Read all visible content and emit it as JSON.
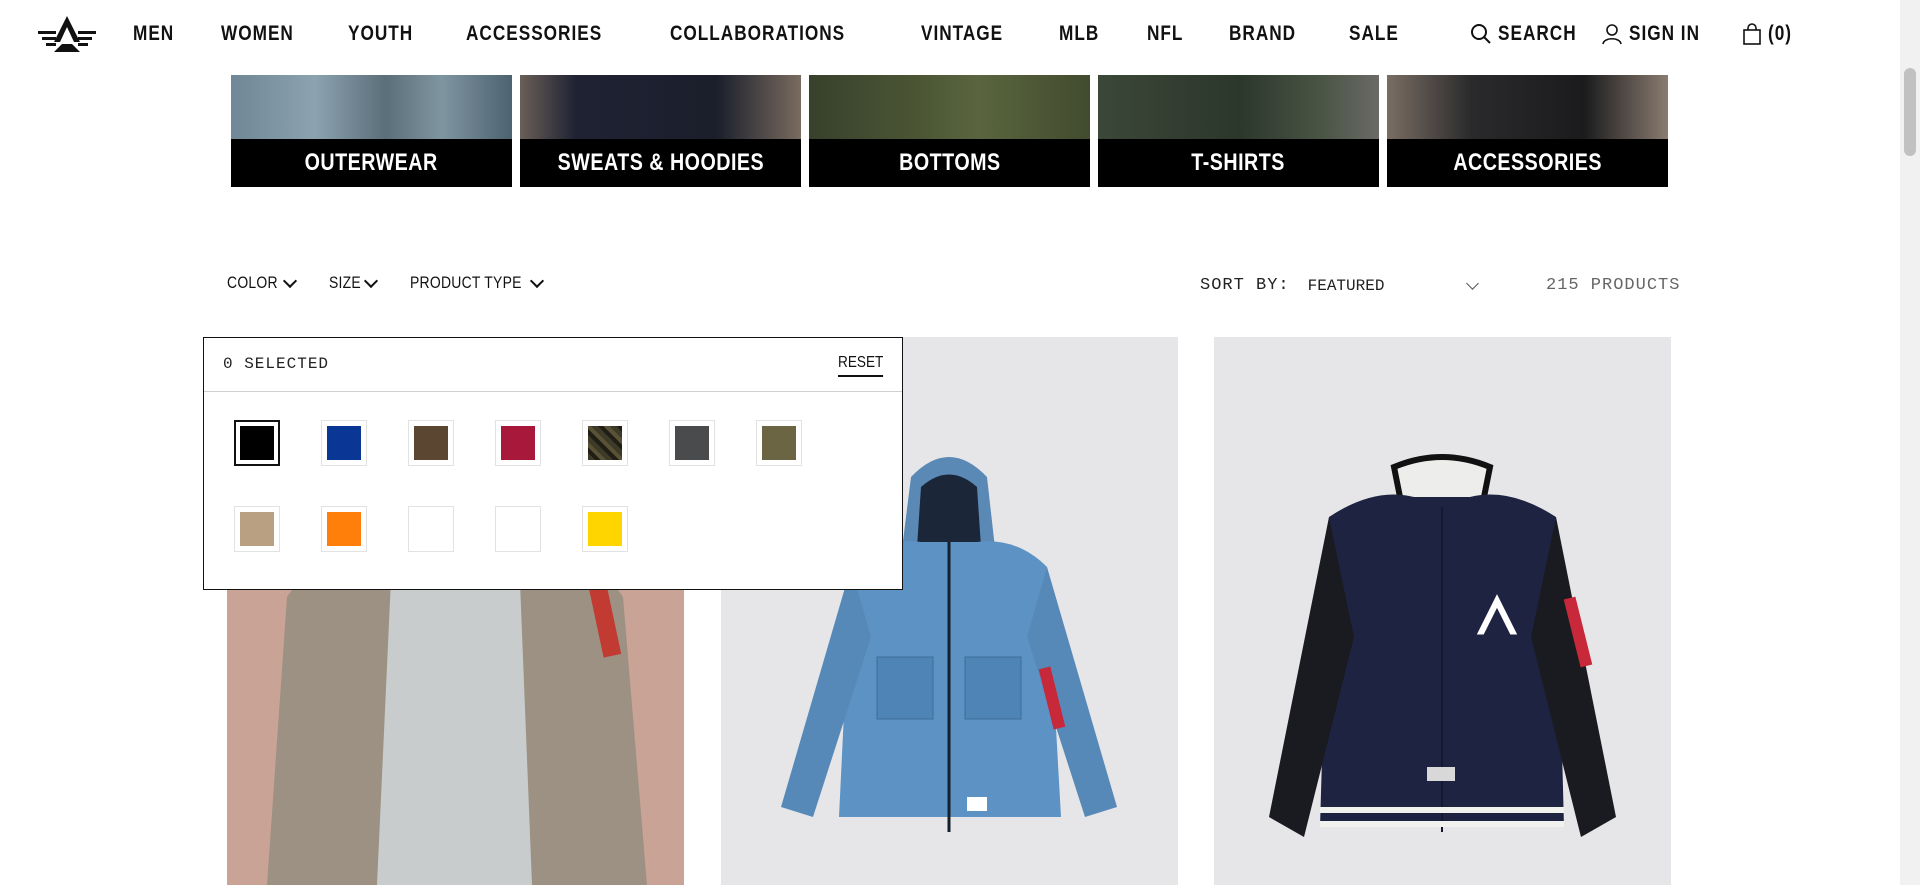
{
  "header": {
    "nav": [
      "MEN",
      "WOMEN",
      "YOUTH",
      "ACCESSORIES",
      "COLLABORATIONS",
      "VINTAGE",
      "MLB",
      "NFL",
      "BRAND",
      "SALE"
    ],
    "search_label": "SEARCH",
    "signin_label": "SIGN IN",
    "cart_label": "(0)"
  },
  "categories": [
    "OUTERWEAR",
    "SWEATS & HOODIES",
    "BOTTOMS",
    "T-SHIRTS",
    "ACCESSORIES"
  ],
  "filters": {
    "color_label": "COLOR",
    "size_label": "SIZE",
    "product_type_label": "PRODUCT TYPE",
    "sort_label": "SORT BY:",
    "sort_value": "FEATURED",
    "product_count": "215 PRODUCTS"
  },
  "color_dropdown": {
    "selected_text": "0 SELECTED",
    "reset_label": "RESET",
    "swatches": [
      {
        "name": "black",
        "color": "#000000"
      },
      {
        "name": "blue",
        "color": "#0a3796"
      },
      {
        "name": "brown",
        "color": "#5b4632"
      },
      {
        "name": "red",
        "color": "#a8183a"
      },
      {
        "name": "camo",
        "color": "#3e3a28"
      },
      {
        "name": "grey",
        "color": "#4a4b4c"
      },
      {
        "name": "olive",
        "color": "#6c6543"
      },
      {
        "name": "tan",
        "color": "#b9a083"
      },
      {
        "name": "orange",
        "color": "#ff7f0a"
      },
      {
        "name": "white",
        "color": "#ffffff"
      },
      {
        "name": "white-2",
        "color": "#ffffff"
      },
      {
        "name": "yellow",
        "color": "#ffd500"
      }
    ]
  }
}
